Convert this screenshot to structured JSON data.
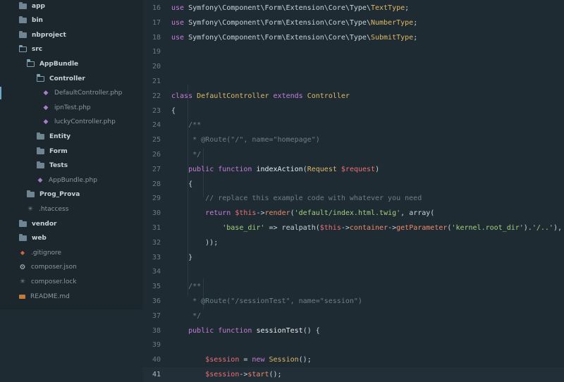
{
  "sidebar": {
    "items": [
      {
        "label": "app",
        "kind": "folder",
        "icon": "folder-icon",
        "indent": 0
      },
      {
        "label": "bin",
        "kind": "folder",
        "icon": "folder-icon",
        "indent": 0
      },
      {
        "label": "nbproject",
        "kind": "folder",
        "icon": "folder-icon",
        "indent": 0
      },
      {
        "label": "src",
        "kind": "folder-open",
        "icon": "folder-open-icon",
        "indent": 0
      },
      {
        "label": "AppBundle",
        "kind": "folder-open",
        "icon": "folder-open-icon",
        "indent": 1
      },
      {
        "label": "Controller",
        "kind": "folder-open",
        "icon": "folder-open-icon",
        "indent": 2
      },
      {
        "label": "DefaultController.php",
        "kind": "php",
        "icon": "php-file-icon",
        "indent": 3,
        "active": true
      },
      {
        "label": "ipnTest.php",
        "kind": "php",
        "icon": "php-file-icon",
        "indent": 3
      },
      {
        "label": "luckyController.php",
        "kind": "php",
        "icon": "php-file-icon",
        "indent": 3
      },
      {
        "label": "Entity",
        "kind": "folder",
        "icon": "folder-icon",
        "indent": 2
      },
      {
        "label": "Form",
        "kind": "folder",
        "icon": "folder-icon",
        "indent": 2
      },
      {
        "label": "Tests",
        "kind": "folder",
        "icon": "folder-icon",
        "indent": 2
      },
      {
        "label": "AppBundle.php",
        "kind": "php",
        "icon": "php-file-icon",
        "indent": 2
      },
      {
        "label": "Prog_Prova",
        "kind": "folder",
        "icon": "folder-icon",
        "indent": 1
      },
      {
        "label": ".htaccess",
        "kind": "star",
        "icon": "config-file-icon",
        "indent": 1
      },
      {
        "label": "vendor",
        "kind": "folder",
        "icon": "folder-icon",
        "indent": 0
      },
      {
        "label": "web",
        "kind": "folder",
        "icon": "folder-icon",
        "indent": 0
      },
      {
        "label": ".gitignore",
        "kind": "git",
        "icon": "git-icon",
        "indent": 0
      },
      {
        "label": "composer.json",
        "kind": "gear",
        "icon": "gear-icon",
        "indent": 0
      },
      {
        "label": "composer.lock",
        "kind": "star",
        "icon": "lock-file-icon",
        "indent": 0
      },
      {
        "label": "README.md",
        "kind": "readme",
        "icon": "markdown-icon",
        "indent": 0
      }
    ]
  },
  "editor": {
    "current_line": "41",
    "lines": [
      {
        "num": "16",
        "html": "<span class='k'>use</span> Symfony\\Component\\Form\\Extension\\Core\\Type\\<span class='t'>TextType</span>;"
      },
      {
        "num": "17",
        "html": "<span class='k'>use</span> Symfony\\Component\\Form\\Extension\\Core\\Type\\<span class='t'>NumberType</span>;"
      },
      {
        "num": "18",
        "html": "<span class='k'>use</span> Symfony\\Component\\Form\\Extension\\Core\\Type\\<span class='t'>SubmitType</span>;"
      },
      {
        "num": "19",
        "html": ""
      },
      {
        "num": "20",
        "html": ""
      },
      {
        "num": "21",
        "html": ""
      },
      {
        "num": "22",
        "html": "<span class='k'>class</span> <span class='t'>DefaultController</span> <span class='k'>extends</span> <span class='t'>Controller</span>"
      },
      {
        "num": "23",
        "html": "{"
      },
      {
        "num": "24",
        "html": "    <span class='c'>/**</span>"
      },
      {
        "num": "25",
        "html": "    <span class='c'> * @Route(\"/\", name=\"homepage\")</span>"
      },
      {
        "num": "26",
        "html": "    <span class='c'> */</span>"
      },
      {
        "num": "27",
        "html": "    <span class='k'>public</span> <span class='k'>function</span> <span class='f'>indexAction</span>(<span class='t'>Request</span> <span class='v'>$request</span>)"
      },
      {
        "num": "28",
        "html": "    {"
      },
      {
        "num": "29",
        "html": "        <span class='c'>// replace this example code with whatever you need</span>"
      },
      {
        "num": "30",
        "html": "        <span class='k'>return</span> <span class='v'>$this</span>-&gt;<span class='m'>render</span>(<span class='s'>'default/index.html.twig'</span>, array("
      },
      {
        "num": "31",
        "html": "            <span class='s'>'base_dir'</span> =&gt; realpath(<span class='v'>$this</span>-&gt;<span class='m'>container</span>-&gt;<span class='m'>getParameter</span>(<span class='s'>'kernel.root_dir'</span>).<span class='s'>'/..'</span>),"
      },
      {
        "num": "32",
        "html": "        ));"
      },
      {
        "num": "33",
        "html": "    }"
      },
      {
        "num": "34",
        "html": ""
      },
      {
        "num": "35",
        "html": "    <span class='c'>/**</span>"
      },
      {
        "num": "36",
        "html": "    <span class='c'> * @Route(\"/sessionTest\", name=\"session\")</span>"
      },
      {
        "num": "37",
        "html": "    <span class='c'> */</span>"
      },
      {
        "num": "38",
        "html": "    <span class='k'>public</span> <span class='k'>function</span> <span class='f'>sessionTest</span>() {"
      },
      {
        "num": "39",
        "html": ""
      },
      {
        "num": "40",
        "html": "        <span class='v'>$session</span> = <span class='k'>new</span> <span class='t'>Session</span>();"
      },
      {
        "num": "41",
        "html": "        <span class='v'>$session</span>-&gt;<span class='m'>start</span>();"
      }
    ]
  },
  "colors": {
    "sidebar_bg": "#1b262d",
    "editor_bg": "#1f2b33",
    "keyword": "#c77ddb",
    "string": "#a6d17a",
    "variable": "#ef6f74",
    "type": "#e0b864",
    "comment": "#6d7f89"
  }
}
